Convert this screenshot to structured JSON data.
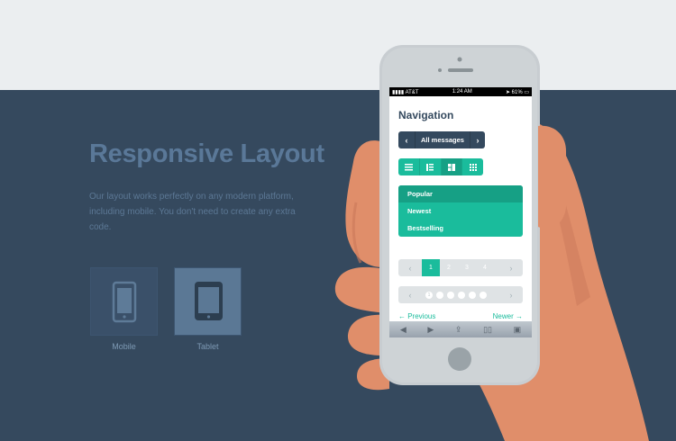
{
  "hero": {
    "title": "Responsive Layout",
    "description": "Our layout works perfectly on any modern platform, including mobile. You don't need to create any extra code."
  },
  "devices": [
    {
      "label": "Mobile",
      "icon": "phone-icon"
    },
    {
      "label": "Tablet",
      "icon": "tablet-icon"
    }
  ],
  "phone": {
    "status": {
      "carrier": "AT&T",
      "time": "1:24 AM",
      "battery": "61%"
    },
    "title": "Navigation",
    "messages_button": {
      "prev": "‹",
      "label": "All messages",
      "next": "›"
    },
    "view_buttons": [
      "list-icon",
      "compact-list-icon",
      "split-view-icon",
      "grid-icon"
    ],
    "menu": [
      "Popular",
      "Newest",
      "Bestselling"
    ],
    "pager_numbers": [
      "1",
      "2",
      "3",
      "4"
    ],
    "pager_dots": {
      "first": "1"
    },
    "links": {
      "previous": "← Previous",
      "newer": "Newer →"
    },
    "toolbar_icons": [
      "back-icon",
      "forward-icon",
      "share-icon",
      "bookmarks-icon",
      "tabs-icon"
    ]
  },
  "colors": {
    "dark_bg": "#35495e",
    "light_bg": "#ebeef0",
    "accent": "#1abc9c",
    "accent_dark": "#16a085",
    "hand": "#e08e6a",
    "phone_body": "#c8cdd1"
  }
}
